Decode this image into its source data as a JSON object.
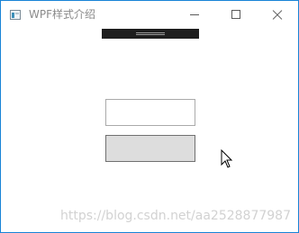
{
  "window": {
    "title": "WPF样式介绍"
  },
  "titlebar": {
    "icon": "window-app-icon",
    "minimize_icon": "minimize-icon",
    "maximize_icon": "maximize-icon",
    "close_icon": "close-icon"
  },
  "content": {
    "textbox_value": "",
    "button_label": ""
  },
  "watermark": {
    "text": "https://blog.csdn.net/aa2528877987"
  },
  "colors": {
    "window_border": "#1883d7",
    "button_background": "#dddddd",
    "textbox_border": "#aaaaaa",
    "toolbar_background": "#1e1e1e"
  }
}
